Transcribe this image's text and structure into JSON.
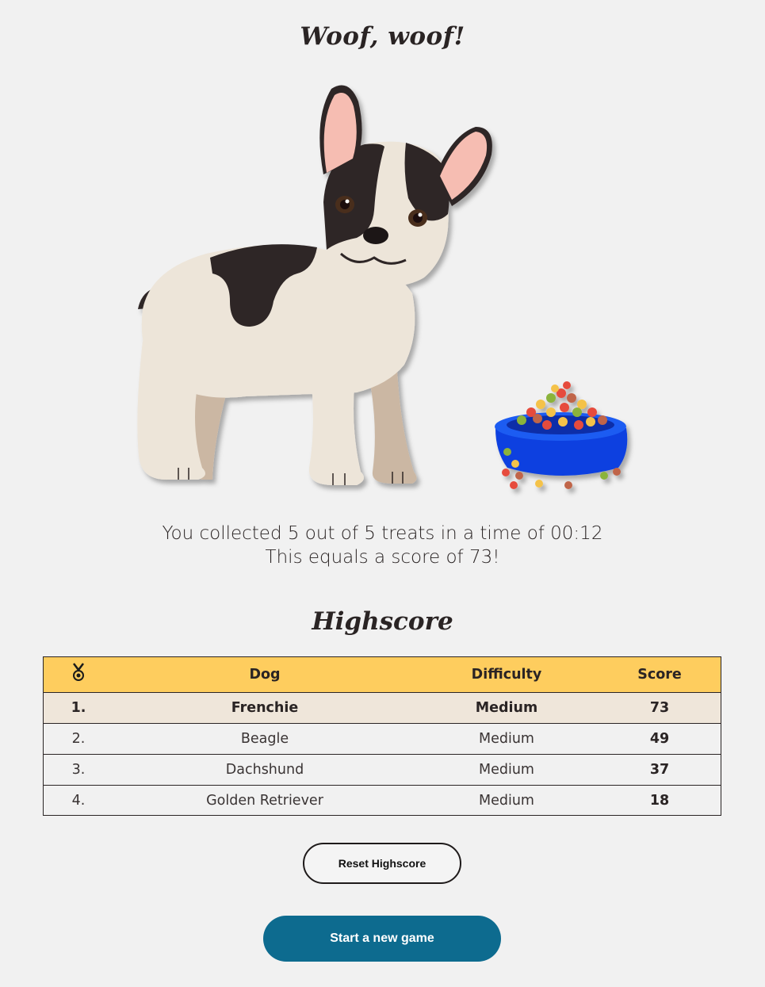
{
  "page": {
    "title": "Woof, woof!"
  },
  "result": {
    "line1": "You collected 5 out of 5 treats in a time of 00:12",
    "line2": "This equals a score of 73!"
  },
  "highscore": {
    "title": "Highscore",
    "columns": {
      "rank_icon": "medal-icon",
      "dog": "Dog",
      "difficulty": "Difficulty",
      "score": "Score"
    },
    "rows": [
      {
        "rank": "1.",
        "dog": "Frenchie",
        "difficulty": "Medium",
        "score": "73"
      },
      {
        "rank": "2.",
        "dog": "Beagle",
        "difficulty": "Medium",
        "score": "49"
      },
      {
        "rank": "3.",
        "dog": "Dachshund",
        "difficulty": "Medium",
        "score": "37"
      },
      {
        "rank": "4.",
        "dog": "Golden Retriever",
        "difficulty": "Medium",
        "score": "18"
      }
    ]
  },
  "buttons": {
    "reset_label": "Reset Highscore",
    "start_label": "Start a new game"
  },
  "colors": {
    "background": "#f1f1f1",
    "header_yellow": "#fecd5e",
    "first_row": "#efe6da",
    "start_button": "#0d6b8f",
    "bowl_blue": "#0a3fe0"
  }
}
